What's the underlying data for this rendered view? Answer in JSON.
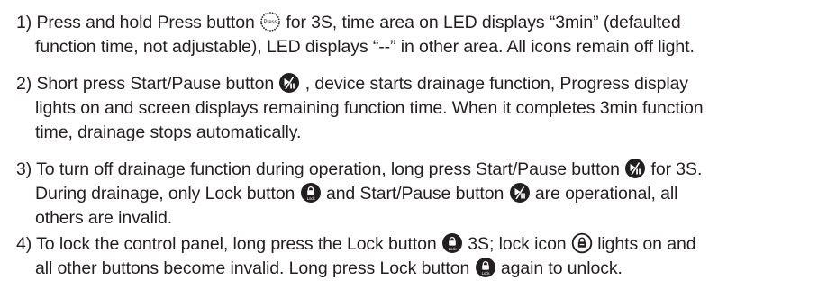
{
  "items": [
    {
      "lines": [
        [
          "1) Press and hold Press button ",
          {
            "icon": "press-dotted-icon",
            "label": "Press"
          },
          " for 3S, time area on LED displays “3min” (defaulted"
        ],
        [
          "function time, not adjustable), LED displays “--” in other area. All icons remain off light."
        ]
      ]
    },
    {
      "lines": [
        [
          "2) Short press Start/Pause button ",
          {
            "icon": "start-pause-icon"
          },
          " , device starts drainage function, Progress display"
        ],
        [
          "lights on and screen displays remaining function time. When it completes 3min function"
        ],
        [
          "time, drainage stops automatically."
        ]
      ]
    },
    {
      "lines": [
        [
          "3) To turn off drainage function during operation, long press Start/Pause button ",
          {
            "icon": "start-pause-icon"
          },
          " for 3S."
        ],
        [
          "During drainage, only Lock button ",
          {
            "icon": "lock-button-icon",
            "label": "Lock"
          },
          " and Start/Pause button ",
          {
            "icon": "start-pause-icon"
          },
          " are operational, all"
        ],
        [
          "others are invalid."
        ]
      ]
    },
    {
      "lines": [
        [
          "4) To lock the control panel, long press the Lock button ",
          {
            "icon": "lock-button-icon",
            "label": "Lock"
          },
          " 3S; lock icon ",
          {
            "icon": "lock-outline-icon"
          },
          " lights on and"
        ],
        [
          "all other buttons become invalid. Long press Lock button ",
          {
            "icon": "lock-button-icon",
            "label": "Lock"
          },
          " again to unlock."
        ]
      ]
    }
  ]
}
